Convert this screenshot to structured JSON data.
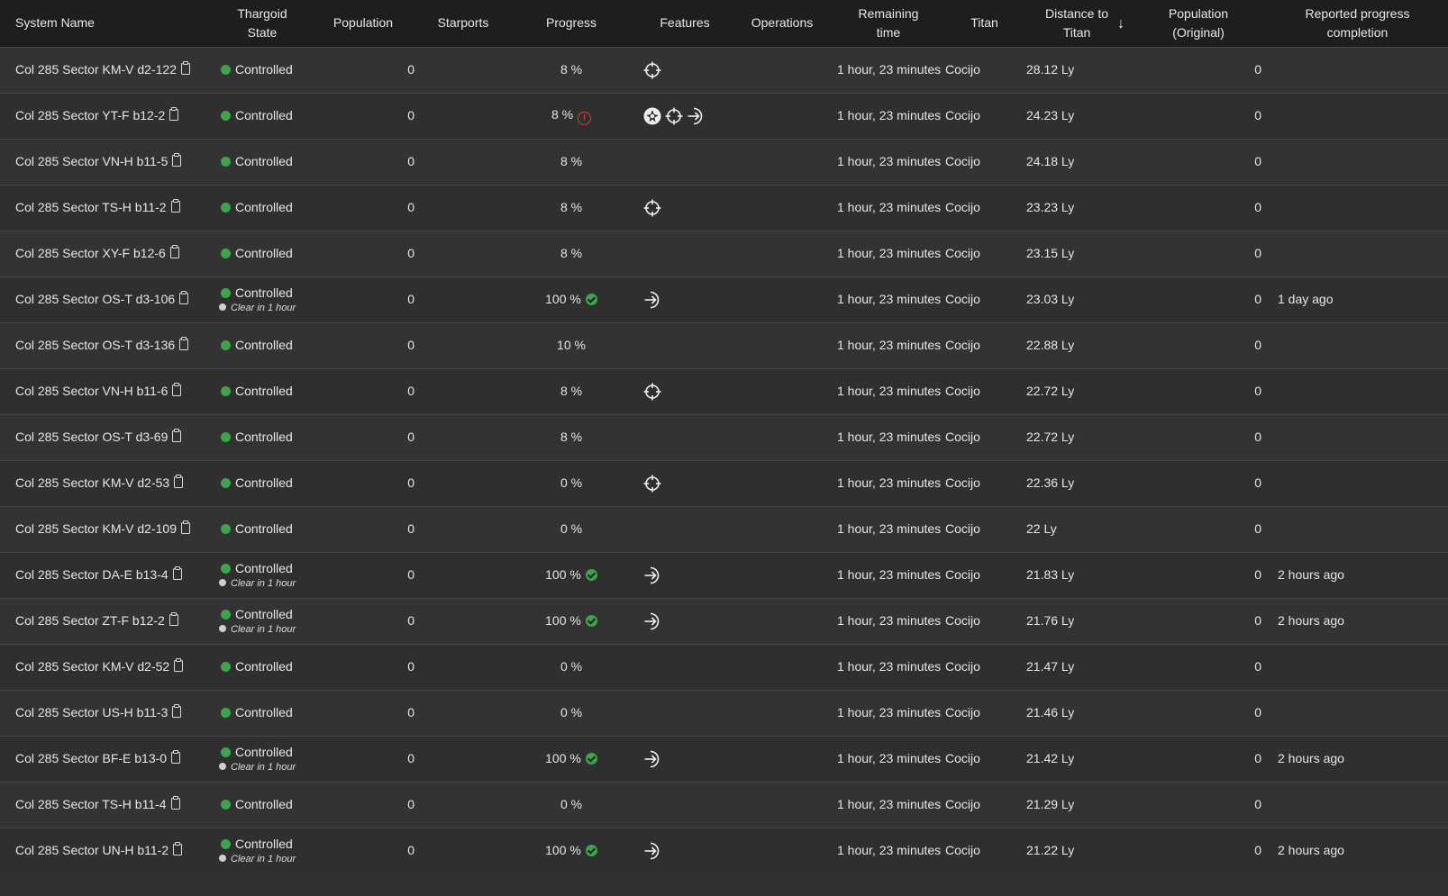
{
  "headers": {
    "system_name": "System Name",
    "thargoid_state_1": "Thargoid",
    "thargoid_state_2": "State",
    "population": "Population",
    "starports": "Starports",
    "progress": "Progress",
    "features": "Features",
    "operations": "Operations",
    "remaining_1": "Remaining",
    "remaining_2": "time",
    "titan": "Titan",
    "distance_1": "Distance to",
    "distance_2": "Titan",
    "sort_arrow": "↓",
    "pop_orig_1": "Population",
    "pop_orig_2": "(Original)",
    "reported_1": "Reported progress",
    "reported_2": "completion"
  },
  "rows": [
    {
      "name": "Col 285 Sector KM-V d2-122",
      "state": "Controlled",
      "sub": "",
      "population": "0",
      "progress": "8 %",
      "progress_icon": "",
      "features": [
        "target-icon"
      ],
      "remaining": "1 hour, 23 minutes",
      "titan": "Cocijo",
      "distance": "28.12 Ly",
      "pop_orig": "0",
      "reported": ""
    },
    {
      "name": "Col 285 Sector YT-F b12-2",
      "state": "Controlled",
      "sub": "",
      "population": "0",
      "progress": "8 %",
      "progress_icon": "warning",
      "features": [
        "thargoid-icon",
        "target-icon",
        "arrow-icon"
      ],
      "remaining": "1 hour, 23 minutes",
      "titan": "Cocijo",
      "distance": "24.23 Ly",
      "pop_orig": "0",
      "reported": ""
    },
    {
      "name": "Col 285 Sector VN-H b11-5",
      "state": "Controlled",
      "sub": "",
      "population": "0",
      "progress": "8 %",
      "progress_icon": "",
      "features": [],
      "remaining": "1 hour, 23 minutes",
      "titan": "Cocijo",
      "distance": "24.18 Ly",
      "pop_orig": "0",
      "reported": ""
    },
    {
      "name": "Col 285 Sector TS-H b11-2",
      "state": "Controlled",
      "sub": "",
      "population": "0",
      "progress": "8 %",
      "progress_icon": "",
      "features": [
        "target-icon"
      ],
      "remaining": "1 hour, 23 minutes",
      "titan": "Cocijo",
      "distance": "23.23 Ly",
      "pop_orig": "0",
      "reported": ""
    },
    {
      "name": "Col 285 Sector XY-F b12-6",
      "state": "Controlled",
      "sub": "",
      "population": "0",
      "progress": "8 %",
      "progress_icon": "",
      "features": [],
      "remaining": "1 hour, 23 minutes",
      "titan": "Cocijo",
      "distance": "23.15 Ly",
      "pop_orig": "0",
      "reported": ""
    },
    {
      "name": "Col 285 Sector OS-T d3-106",
      "state": "Controlled",
      "sub": "Clear in 1 hour",
      "population": "0",
      "progress": "100 %",
      "progress_icon": "check",
      "features": [
        "arrow-icon"
      ],
      "remaining": "1 hour, 23 minutes",
      "titan": "Cocijo",
      "distance": "23.03 Ly",
      "pop_orig": "0",
      "reported": "1 day ago"
    },
    {
      "name": "Col 285 Sector OS-T d3-136",
      "state": "Controlled",
      "sub": "",
      "population": "0",
      "progress": "10 %",
      "progress_icon": "",
      "features": [],
      "remaining": "1 hour, 23 minutes",
      "titan": "Cocijo",
      "distance": "22.88 Ly",
      "pop_orig": "0",
      "reported": ""
    },
    {
      "name": "Col 285 Sector VN-H b11-6",
      "state": "Controlled",
      "sub": "",
      "population": "0",
      "progress": "8 %",
      "progress_icon": "",
      "features": [
        "target-icon"
      ],
      "remaining": "1 hour, 23 minutes",
      "titan": "Cocijo",
      "distance": "22.72 Ly",
      "pop_orig": "0",
      "reported": ""
    },
    {
      "name": "Col 285 Sector OS-T d3-69",
      "state": "Controlled",
      "sub": "",
      "population": "0",
      "progress": "8 %",
      "progress_icon": "",
      "features": [],
      "remaining": "1 hour, 23 minutes",
      "titan": "Cocijo",
      "distance": "22.72 Ly",
      "pop_orig": "0",
      "reported": ""
    },
    {
      "name": "Col 285 Sector KM-V d2-53",
      "state": "Controlled",
      "sub": "",
      "population": "0",
      "progress": "0 %",
      "progress_icon": "",
      "features": [
        "target-icon"
      ],
      "remaining": "1 hour, 23 minutes",
      "titan": "Cocijo",
      "distance": "22.36 Ly",
      "pop_orig": "0",
      "reported": ""
    },
    {
      "name": "Col 285 Sector KM-V d2-109",
      "state": "Controlled",
      "sub": "",
      "population": "0",
      "progress": "0 %",
      "progress_icon": "",
      "features": [],
      "remaining": "1 hour, 23 minutes",
      "titan": "Cocijo",
      "distance": "22 Ly",
      "pop_orig": "0",
      "reported": ""
    },
    {
      "name": "Col 285 Sector DA-E b13-4",
      "state": "Controlled",
      "sub": "Clear in 1 hour",
      "population": "0",
      "progress": "100 %",
      "progress_icon": "check",
      "features": [
        "arrow-icon"
      ],
      "remaining": "1 hour, 23 minutes",
      "titan": "Cocijo",
      "distance": "21.83 Ly",
      "pop_orig": "0",
      "reported": "2 hours ago"
    },
    {
      "name": "Col 285 Sector ZT-F b12-2",
      "state": "Controlled",
      "sub": "Clear in 1 hour",
      "population": "0",
      "progress": "100 %",
      "progress_icon": "check",
      "features": [
        "arrow-icon"
      ],
      "remaining": "1 hour, 23 minutes",
      "titan": "Cocijo",
      "distance": "21.76 Ly",
      "pop_orig": "0",
      "reported": "2 hours ago"
    },
    {
      "name": "Col 285 Sector KM-V d2-52",
      "state": "Controlled",
      "sub": "",
      "population": "0",
      "progress": "0 %",
      "progress_icon": "",
      "features": [],
      "remaining": "1 hour, 23 minutes",
      "titan": "Cocijo",
      "distance": "21.47 Ly",
      "pop_orig": "0",
      "reported": ""
    },
    {
      "name": "Col 285 Sector US-H b11-3",
      "state": "Controlled",
      "sub": "",
      "population": "0",
      "progress": "0 %",
      "progress_icon": "",
      "features": [],
      "remaining": "1 hour, 23 minutes",
      "titan": "Cocijo",
      "distance": "21.46 Ly",
      "pop_orig": "0",
      "reported": ""
    },
    {
      "name": "Col 285 Sector BF-E b13-0",
      "state": "Controlled",
      "sub": "Clear in 1 hour",
      "population": "0",
      "progress": "100 %",
      "progress_icon": "check",
      "features": [
        "arrow-icon"
      ],
      "remaining": "1 hour, 23 minutes",
      "titan": "Cocijo",
      "distance": "21.42 Ly",
      "pop_orig": "0",
      "reported": "2 hours ago"
    },
    {
      "name": "Col 285 Sector TS-H b11-4",
      "state": "Controlled",
      "sub": "",
      "population": "0",
      "progress": "0 %",
      "progress_icon": "",
      "features": [],
      "remaining": "1 hour, 23 minutes",
      "titan": "Cocijo",
      "distance": "21.29 Ly",
      "pop_orig": "0",
      "reported": ""
    },
    {
      "name": "Col 285 Sector UN-H b11-2",
      "state": "Controlled",
      "sub": "Clear in 1 hour",
      "population": "0",
      "progress": "100 %",
      "progress_icon": "check",
      "features": [
        "arrow-icon"
      ],
      "remaining": "1 hour, 23 minutes",
      "titan": "Cocijo",
      "distance": "21.22 Ly",
      "pop_orig": "0",
      "reported": "2 hours ago"
    }
  ]
}
